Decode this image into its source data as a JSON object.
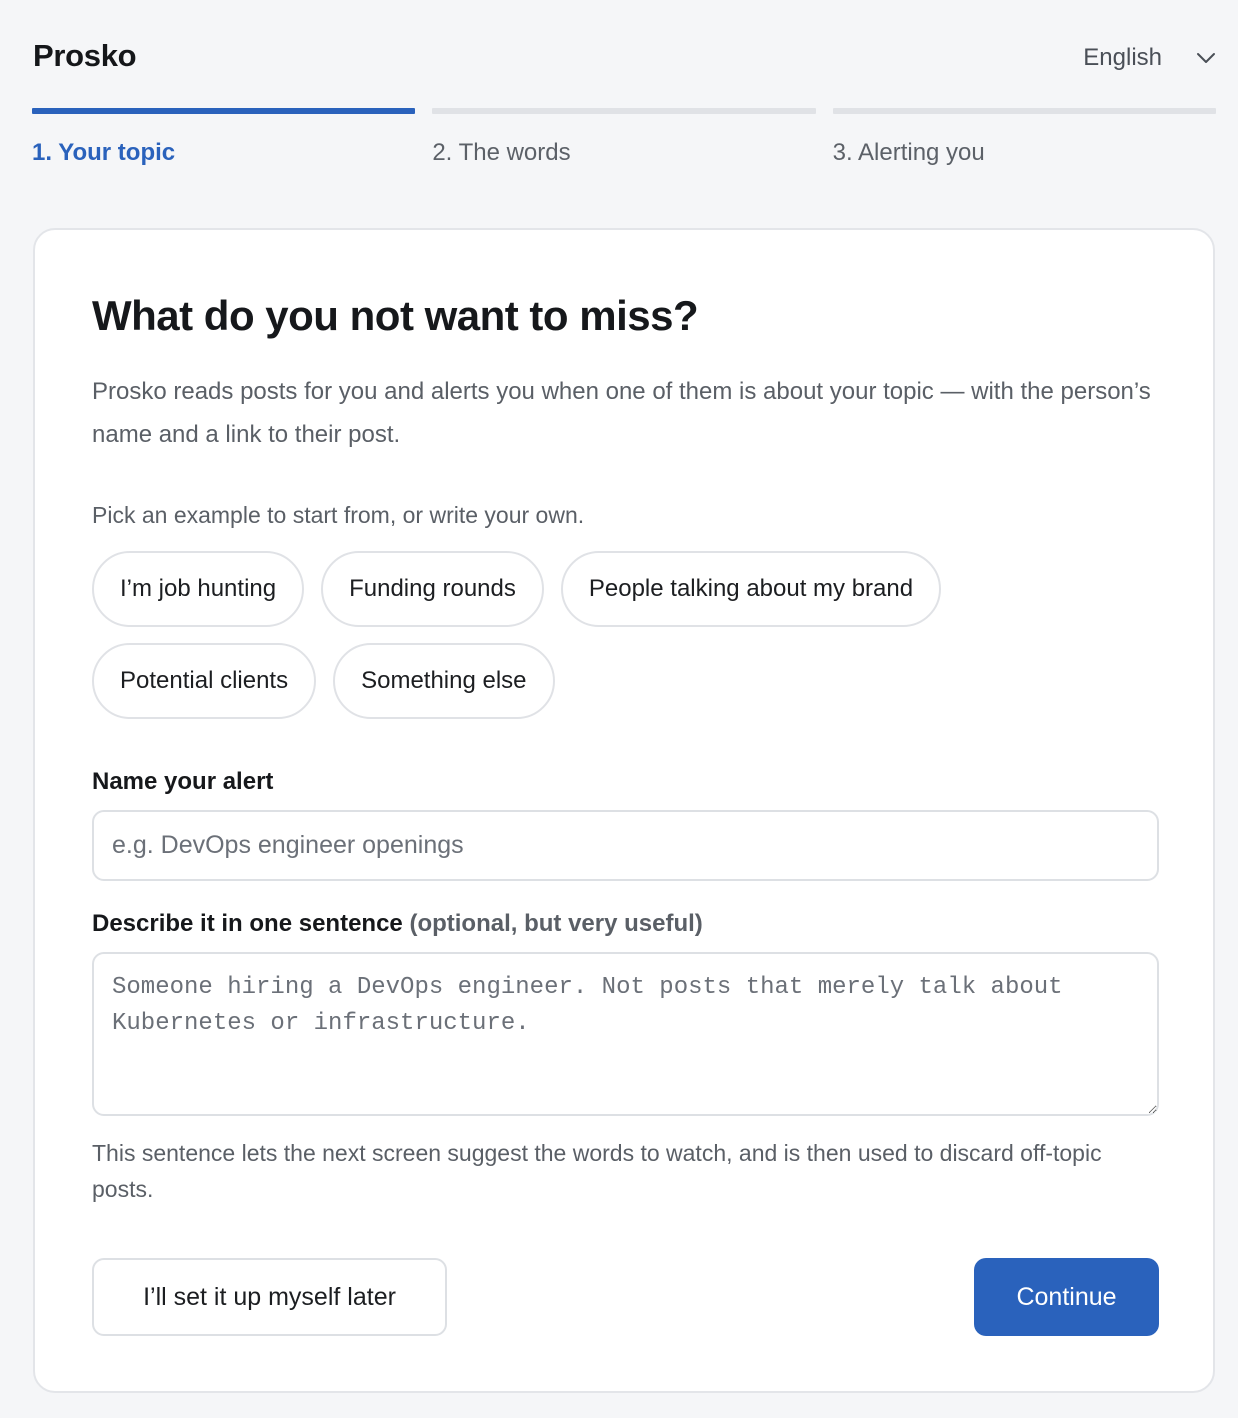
{
  "app": {
    "brand": "Prosko"
  },
  "language": {
    "selected": "English",
    "icon": "chevron-down-icon"
  },
  "steps": [
    {
      "label": "1. Your topic",
      "active": true
    },
    {
      "label": "2. The words",
      "active": false
    },
    {
      "label": "3. Alerting you",
      "active": false
    }
  ],
  "card": {
    "title": "What do you not want to miss?",
    "intro": "Prosko reads posts for you and alerts you when one of them is about your topic — with the person’s name and a link to their post.",
    "pick_prompt": "Pick an example to start from, or write your own.",
    "examples": [
      "I’m job hunting",
      "Funding rounds",
      "People talking about my brand",
      "Potential clients",
      "Something else"
    ],
    "name_field": {
      "label": "Name your alert",
      "value": "",
      "placeholder": "e.g. DevOps engineer openings"
    },
    "describe_field": {
      "label": "Describe it in one sentence",
      "label_note": "(optional, but very useful)",
      "value": "",
      "placeholder": "Someone hiring a DevOps engineer. Not posts that merely talk about Kubernetes or infrastructure."
    },
    "help_text": "This sentence lets the next screen suggest the words to watch, and is then used to discard off-topic posts.",
    "secondary_button": "I’ll set it up myself later",
    "primary_button": "Continue"
  },
  "colors": {
    "accent": "#2a62bc",
    "background": "#f5f6f8",
    "card": "#ffffff",
    "border": "#e0e2e6",
    "muted_text": "#5a5f66"
  }
}
